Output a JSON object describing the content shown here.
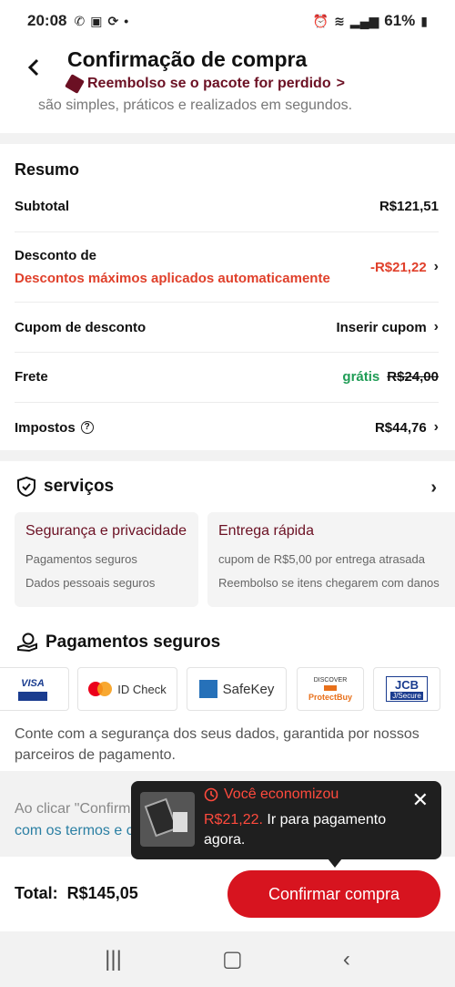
{
  "status": {
    "time": "20:08",
    "battery": "61%"
  },
  "header": {
    "back_icon": "chevron-left-icon",
    "title": "Confirmação de compra",
    "refund_text": "Reembolso se o pacote for perdido",
    "refund_chevron": ">"
  },
  "cut_text": "são simples, práticos e realizados em segundos.",
  "summary": {
    "title": "Resumo",
    "subtotal_label": "Subtotal",
    "subtotal_value": "R$121,51",
    "discount_label": "Desconto de",
    "discount_note": "Descontos máximos aplicados automaticamente",
    "discount_value": "-R$21,22",
    "coupon_label": "Cupom de desconto",
    "coupon_value": "Inserir cupom",
    "shipping_label": "Frete",
    "shipping_free": "grátis",
    "shipping_old": "R$24,00",
    "taxes_label": "Impostos",
    "taxes_value": "R$44,76"
  },
  "services": {
    "title": "serviços",
    "cards": [
      {
        "title": "Segurança e privacidade",
        "lines": [
          "Pagamentos seguros",
          "Dados pessoais seguros"
        ]
      },
      {
        "title": "Entrega rápida",
        "lines": [
          "cupom de R$5,00 por entrega atrasada",
          "Reembolso se itens chegarem com danos"
        ]
      }
    ]
  },
  "payments": {
    "title": "Pagamentos seguros",
    "logos": [
      "VISA",
      "ID Check",
      "SafeKey",
      "ProtectBuy",
      "JCB"
    ],
    "description": "Conte com a segurança dos seus dados, garantida por nossos parceiros de pagamento."
  },
  "legal": {
    "text_start": "Ao clicar \"Confirmar compra\", confirmo que li e estou de acordo",
    "link_text": "com os termos e condições de uso",
    "text_end": "."
  },
  "toast": {
    "title": "Você economizou",
    "amount": "R$21,22.",
    "action": "Ir para pagamento agora."
  },
  "bottom": {
    "total_label": "Total:",
    "total_value": "R$145,05",
    "confirm_label": "Confirmar compra"
  },
  "colors": {
    "accent": "#d7141f",
    "brand": "#6b1023",
    "discount": "#e0402b",
    "free": "#1f9c55"
  }
}
